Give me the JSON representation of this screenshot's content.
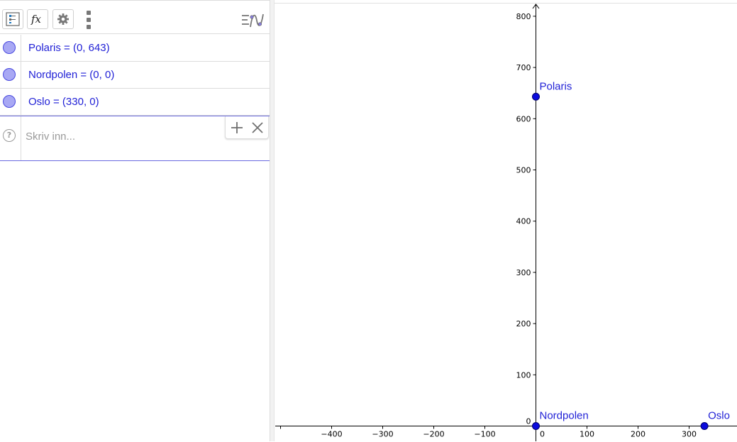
{
  "algebra": {
    "rows": [
      {
        "formula": "Polaris = (0, 643)"
      },
      {
        "formula": "Nordpolen = (0, 0)"
      },
      {
        "formula": "Oslo = (330, 0)"
      }
    ],
    "input": {
      "placeholder": "Skriv inn...",
      "help_glyph": "?"
    }
  },
  "toolbar": {
    "buttons": [
      "algebra-view-icon",
      "fx-icon",
      "gear-icon",
      "menu-dots-icon"
    ],
    "view_toggle_icon": "algebra-graphics-toggle-icon"
  },
  "graphics": {
    "x_ticks": [
      "−400",
      "−300",
      "−200",
      "−100",
      "0",
      "100",
      "200",
      "300"
    ],
    "y_ticks": [
      "800",
      "700",
      "600",
      "500",
      "400",
      "300",
      "200",
      "100",
      "0"
    ],
    "points": [
      {
        "name": "Polaris",
        "x": 0,
        "y": 643
      },
      {
        "name": "Nordpolen",
        "x": 0,
        "y": 0
      },
      {
        "name": "Oslo",
        "x": 330,
        "y": 0
      }
    ]
  },
  "colors": {
    "point_fill": "#0b0bdd",
    "label": "#1f1fd6",
    "marble_fill": "#a8a8f4"
  }
}
